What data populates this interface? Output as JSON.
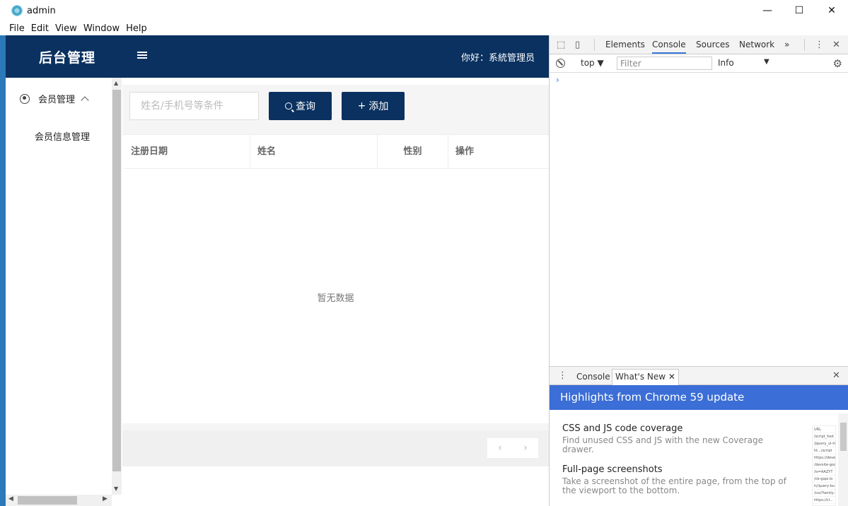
{
  "window": {
    "title": "admin",
    "minimize": "—",
    "maximize": "☐",
    "close": "✕"
  },
  "menubar": [
    "File",
    "Edit",
    "View",
    "Window",
    "Help"
  ],
  "app": {
    "logo": "后台管理",
    "greeting": "你好：系統管理员",
    "sidebar": {
      "group": "会员管理",
      "items": [
        "会员信息管理"
      ]
    },
    "search": {
      "placeholder": "姓名/手机号等条件",
      "search_label": "查询",
      "add_label": "添加"
    },
    "table": {
      "columns": [
        "注册日期",
        "姓名",
        "性别",
        "操作"
      ],
      "empty": "暂无数据"
    },
    "pager": {
      "prev": "‹",
      "next": "›"
    }
  },
  "devtools": {
    "tabs": [
      "Elements",
      "Console",
      "Sources",
      "Network"
    ],
    "active_tab": "Console",
    "more": "»",
    "context": "top",
    "filter_placeholder": "Filter",
    "level": "Info",
    "prompt": "›",
    "drawer_tabs": [
      "Console",
      "What's New"
    ],
    "highlights_title": "Highlights from Chrome 59 update",
    "features": [
      {
        "title": "CSS and JS code coverage",
        "desc": "Find unused CSS and JS with the new Coverage drawer."
      },
      {
        "title": "Full-page screenshots",
        "desc": "Take a screenshot of the entire page, from the top of the viewport to the bottom."
      }
    ],
    "thumbnail_lines": [
      "URL",
      "/script_foot",
      "/jquery_ui-tr",
      "ht.../script",
      "https://deve",
      "/devsite-goo",
      "/is=AAZYT",
      "/cb-gapi.lo",
      "h//query-bu",
      "/css?family-",
      "https://cl...",
      "https://cl..."
    ]
  },
  "colors": {
    "header": "#0a3160",
    "accent": "#3b6ed6"
  }
}
